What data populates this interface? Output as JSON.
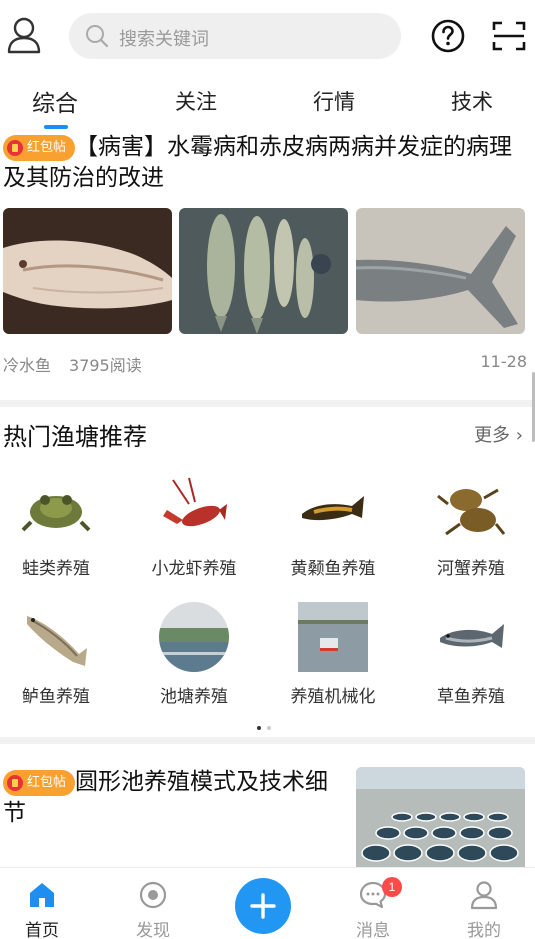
{
  "search": {
    "placeholder": "搜索关键词"
  },
  "tabs": [
    {
      "label": "综合",
      "active": true
    },
    {
      "label": "关注"
    },
    {
      "label": "行情"
    },
    {
      "label": "技术"
    }
  ],
  "article1": {
    "tag": "红包帖",
    "title": "【病害】水霉病和赤皮病两病并发症的病理及其防治的改进",
    "category": "冷水鱼",
    "reads": "3795阅读",
    "date": "11-28"
  },
  "recommend": {
    "title": "热门渔塘推荐",
    "more": "更多",
    "items": [
      {
        "label": "蛙类养殖"
      },
      {
        "label": "小龙虾养殖"
      },
      {
        "label": "黄颡鱼养殖"
      },
      {
        "label": "河蟹养殖"
      },
      {
        "label": "鲈鱼养殖"
      },
      {
        "label": "池塘养殖"
      },
      {
        "label": "养殖机械化"
      },
      {
        "label": "草鱼养殖"
      }
    ]
  },
  "article2": {
    "tag": "红包帖",
    "title": "圆形池养殖模式及技术细节"
  },
  "nav": {
    "items": [
      {
        "label": "首页",
        "active": true
      },
      {
        "label": "发现"
      },
      {
        "label": "消息"
      },
      {
        "label": "我的"
      }
    ],
    "badge": "1"
  },
  "colors": {
    "accent": "#2196f3",
    "tag": "#f8a030",
    "badge": "#ff4a4a"
  }
}
